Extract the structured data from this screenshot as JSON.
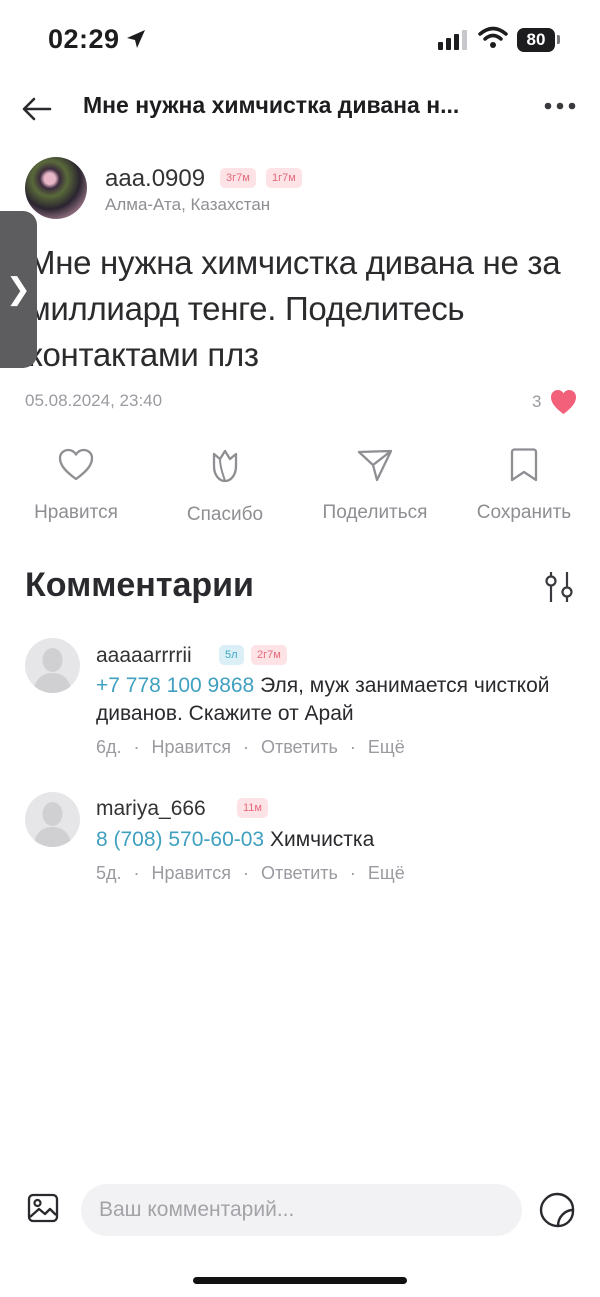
{
  "status_bar": {
    "time": "02:29",
    "battery": "80"
  },
  "header": {
    "title": "Мне нужна химчистка дивана н..."
  },
  "author": {
    "username": "aaa.0909",
    "badges": [
      "3г7м",
      "1г7м"
    ],
    "location": "Алма-Ата, Казахстан"
  },
  "post": {
    "text": "Мне нужна химчистка дивана не за миллиард тенге. Поделитесь контактами плз",
    "date": "05.08.2024, 23:40",
    "likes": "3"
  },
  "actions": {
    "like": "Нравится",
    "thanks": "Спасибо",
    "share": "Поделиться",
    "save": "Сохранить"
  },
  "comments_section": {
    "title": "Комментарии",
    "comments": [
      {
        "username": "aaaaarrrrii",
        "badges": [
          "5л",
          "2г7м"
        ],
        "phone": "+7 778 100 9868",
        "text": " Эля, муж занимается чисткой диванов. Скажите от Арай",
        "age": "6д.",
        "like": "Нравится",
        "reply": "Ответить",
        "more": "Ещё"
      },
      {
        "username": "mariya_666",
        "badges": [
          "11м"
        ],
        "phone": "8 (708) 570-60-03",
        "text": " Химчистка",
        "age": "5д.",
        "like": "Нравится",
        "reply": "Ответить",
        "more": "Ещё"
      }
    ]
  },
  "composer": {
    "placeholder": "Ваш комментарий..."
  },
  "colors": {
    "accent": "#3fa0c0",
    "heart": "#f2607a",
    "muted": "#8e8e93"
  }
}
